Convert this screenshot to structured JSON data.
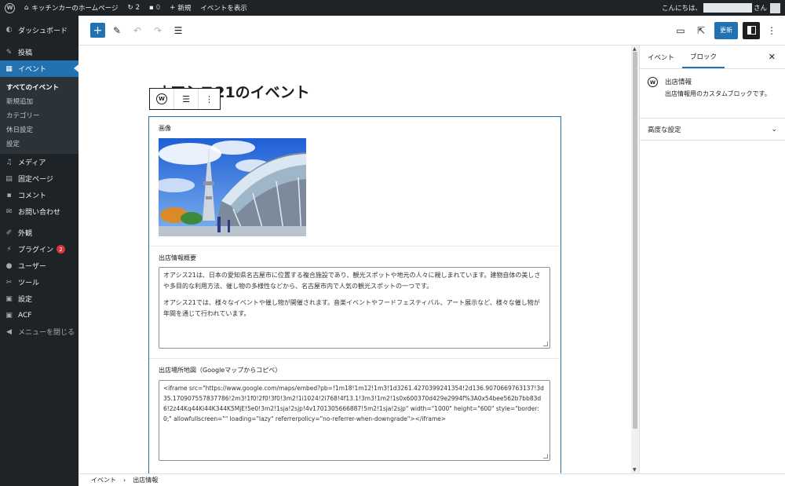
{
  "admin_bar": {
    "site_name": "キッチンカーのホームページ",
    "updates_count": "2",
    "comments_count": "0",
    "new_label": "新規",
    "view_label": "イベントを表示",
    "greeting": "こんにちは、",
    "greeting_suffix": "さん"
  },
  "sidebar": {
    "dashboard": "ダッシュボード",
    "posts": "投稿",
    "events": "イベント",
    "events_sub": [
      "すべてのイベント",
      "新規追加",
      "カテゴリー",
      "休日設定",
      "設定"
    ],
    "media": "メディア",
    "pages": "固定ページ",
    "comments": "コメント",
    "contact": "お問い合わせ",
    "appearance": "外観",
    "plugins": "プラグイン",
    "plugins_badge": "2",
    "users": "ユーザー",
    "tools": "ツール",
    "settings": "設定",
    "acf": "ACF",
    "collapse": "メニューを閉じる"
  },
  "toolbar": {
    "update_label": "更新"
  },
  "editor": {
    "post_title": "オアシス21のイベント",
    "image_label": "画像",
    "overview_label": "出店情報概要",
    "overview_paragraphs": [
      "オアシス21は、日本の愛知県名古屋市に位置する複合施設であり、観光スポットや地元の人々に親しまれています。建物自体の美しさや多目的な利用方法、催し物の多様性などから、名古屋市内で人気の観光スポットの一つです。",
      "オアシス21では、様々なイベントや催し物が開催されます。音楽イベントやフードフェスティバル、アート展示など、様々な催し物が年間を通じて行われています。"
    ],
    "map_label": "出店場所地図（Googleマップからコピペ）",
    "map_code": "<iframe src=\"https://www.google.com/maps/embed?pb=!1m18!1m12!1m3!1d3261.4270399241354!2d136.9070669763137!3d35.170907557837786!2m3!1f0!2f0!3f0!3m2!1i1024!2i768!4f13.1!3m3!1m2!1s0x600370d429e2994f%3A0x54bee562b7bb83d6!2z44Kq44Ki44K344K5MjE!5e0!3m2!1sja!2sjp!4v1701305666887!5m2!1sja!2sjp\" width=\"1000\" height=\"600\" style=\"border:0;\" allowfullscreen=\"\" loading=\"lazy\" referrerpolicy=\"no-referrer-when-downgrade\"></iframe>"
  },
  "breadcrumb": [
    "イベント",
    "出店情報"
  ],
  "settings_panel": {
    "tab_post": "イベント",
    "tab_block": "ブロック",
    "block_title": "出店情報",
    "block_desc": "出店情報用のカスタムブロックです。",
    "advanced": "高度な設定"
  },
  "colors": {
    "admin_dark": "#1d2327",
    "accent": "#2271b1",
    "badge": "#d63638"
  }
}
